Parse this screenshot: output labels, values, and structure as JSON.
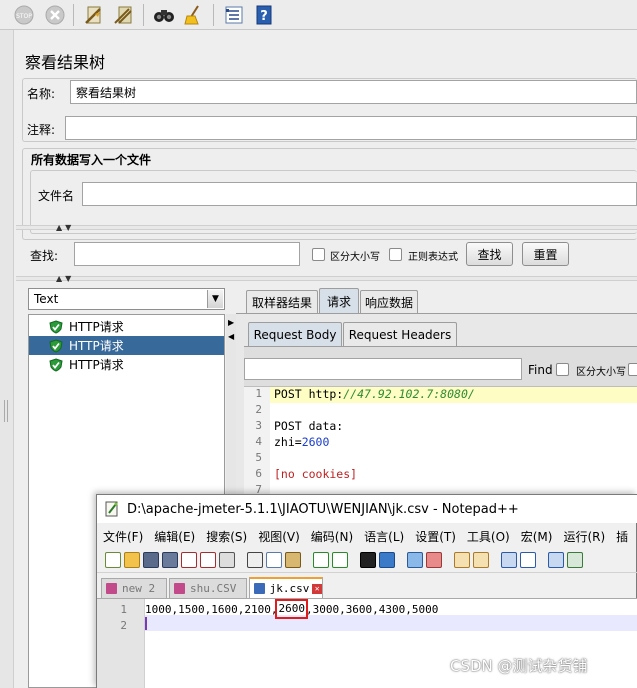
{
  "toolbar": {
    "icons": [
      "stop-icon",
      "shutdown-icon",
      "clear-icon",
      "clear-all-icon",
      "search-icon",
      "reset-search-icon",
      "function-helper-icon",
      "help-icon"
    ]
  },
  "panel": {
    "title": "察看结果树",
    "name_label": "名称:",
    "name_value": "察看结果树",
    "comment_label": "注释:",
    "comment_value": "",
    "file_group_title": "所有数据写入一个文件",
    "filename_label": "文件名",
    "filename_value": "",
    "search_label": "查找:",
    "search_value": "",
    "case_sensitive_label": "区分大小写",
    "regex_label": "正则表达式",
    "search_button": "查找",
    "reset_button": "重置"
  },
  "results": {
    "renderer_selected": "Text",
    "tree_items": [
      {
        "label": "HTTP请求",
        "selected": false
      },
      {
        "label": "HTTP请求",
        "selected": true
      },
      {
        "label": "HTTP请求",
        "selected": false
      }
    ],
    "tabs": [
      "取样器结果",
      "请求",
      "响应数据"
    ],
    "active_tab": "请求",
    "sub_tabs": [
      "Request Body",
      "Request Headers"
    ],
    "active_sub_tab": "Request Body",
    "find_label": "Find",
    "find_case_label": "区分大小写",
    "code_lines": [
      {
        "num": "1",
        "parts": [
          {
            "text": "POST http:",
            "style": "plain"
          },
          {
            "text": "//47.92.102.7:8080/",
            "style": "url"
          }
        ]
      },
      {
        "num": "2",
        "parts": []
      },
      {
        "num": "3",
        "parts": [
          {
            "text": "POST data:",
            "style": "plain"
          }
        ]
      },
      {
        "num": "4",
        "parts": [
          {
            "text": "zhi=",
            "style": "plain"
          },
          {
            "text": "2600",
            "style": "number"
          }
        ]
      },
      {
        "num": "5",
        "parts": []
      },
      {
        "num": "6",
        "parts": [
          {
            "text": "[no cookies]",
            "style": "bracket"
          }
        ]
      },
      {
        "num": "7",
        "parts": []
      }
    ]
  },
  "notepad": {
    "title": "D:\\apache-jmeter-5.1.1\\JIAOTU\\WENJIAN\\jk.csv - Notepad++",
    "menu": [
      "文件(F)",
      "编辑(E)",
      "搜索(S)",
      "视图(V)",
      "编码(N)",
      "语言(L)",
      "设置(T)",
      "工具(O)",
      "宏(M)",
      "运行(R)",
      "插"
    ],
    "tabs": [
      {
        "label": "new 2",
        "active": false
      },
      {
        "label": "shu.CSV",
        "active": false
      },
      {
        "label": "jk.csv",
        "active": true
      }
    ],
    "lines": [
      {
        "num": "1",
        "before": "1000,1500,1600,2100,",
        "highlight": "2600",
        "after": ",3000,3600,4300,5000"
      },
      {
        "num": "2",
        "before": "",
        "highlight": "",
        "after": ""
      }
    ]
  },
  "watermark": "CSDN @测试杂货铺",
  "colors": {
    "selection": "#38699b",
    "highlight_box": "#e11b1b",
    "url_green": "#2e8b2e",
    "number_blue": "#1a3cc9",
    "bracket_red": "#c02020",
    "current_line": "#fdfdc4"
  }
}
